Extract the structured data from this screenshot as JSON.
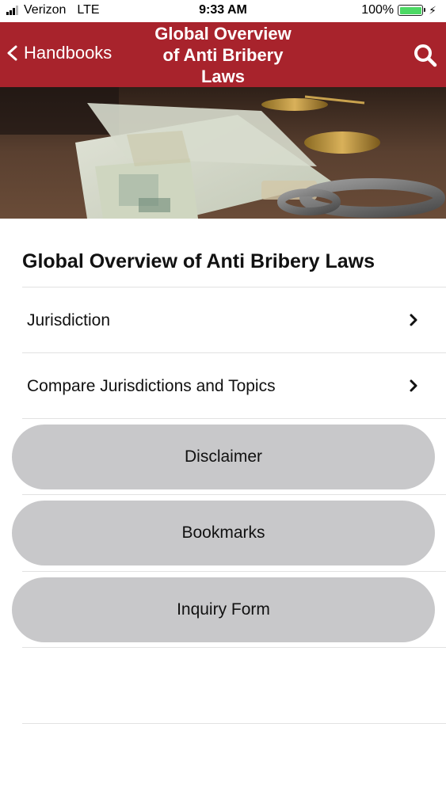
{
  "status_bar": {
    "carrier": "Verizon",
    "network": "LTE",
    "time": "9:33 AM",
    "battery": "100%",
    "battery_color": "#4cd964"
  },
  "nav": {
    "back_label": "Handbooks",
    "title_line1": "Global Overview",
    "title_line2": "of Anti Bribery",
    "title_line3": "Laws",
    "back_icon": "chevron-left-icon",
    "search_icon": "search-icon",
    "bar_color": "#a8232c"
  },
  "hero": {
    "image_icon": "money-scales-handcuffs-image"
  },
  "main": {
    "title": "Global Overview of Anti Bribery Laws",
    "list_items": [
      {
        "label": "Jurisdiction"
      },
      {
        "label": "Compare Jurisdictions and Topics"
      }
    ],
    "buttons": [
      {
        "label": "Disclaimer"
      },
      {
        "label": "Bookmarks"
      },
      {
        "label": "Inquiry Form"
      }
    ]
  }
}
